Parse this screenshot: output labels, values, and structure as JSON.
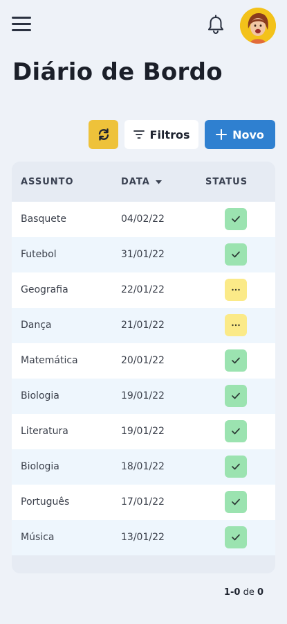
{
  "header": {
    "menu_icon": "hamburger-menu-icon",
    "notification_icon": "bell-icon",
    "avatar_icon": "user-avatar"
  },
  "page": {
    "title": "Diário de Bordo"
  },
  "toolbar": {
    "refresh_icon": "refresh-icon",
    "filter_label": "Filtros",
    "new_label": "Novo"
  },
  "table": {
    "columns": {
      "subject": "ASSUNTO",
      "date": "DATA",
      "status": "STATUS"
    },
    "rows": [
      {
        "subject": "Basquete",
        "date": "04/02/22",
        "status": "done"
      },
      {
        "subject": "Futebol",
        "date": "31/01/22",
        "status": "done"
      },
      {
        "subject": "Geografia",
        "date": "22/01/22",
        "status": "pending"
      },
      {
        "subject": "Dança",
        "date": "21/01/22",
        "status": "pending"
      },
      {
        "subject": "Matemática",
        "date": "20/01/22",
        "status": "done"
      },
      {
        "subject": "Biologia",
        "date": "19/01/22",
        "status": "done"
      },
      {
        "subject": "Literatura",
        "date": "19/01/22",
        "status": "done"
      },
      {
        "subject": "Biologia",
        "date": "18/01/22",
        "status": "done"
      },
      {
        "subject": "Português",
        "date": "17/01/22",
        "status": "done"
      },
      {
        "subject": "Música",
        "date": "13/01/22",
        "status": "done"
      }
    ]
  },
  "pagination": {
    "range": "1-0",
    "of": "de",
    "total": "0"
  },
  "colors": {
    "accent_blue": "#2f80d0",
    "accent_yellow": "#eec23a",
    "status_done": "#9be3b0",
    "status_pending": "#fbea88"
  }
}
